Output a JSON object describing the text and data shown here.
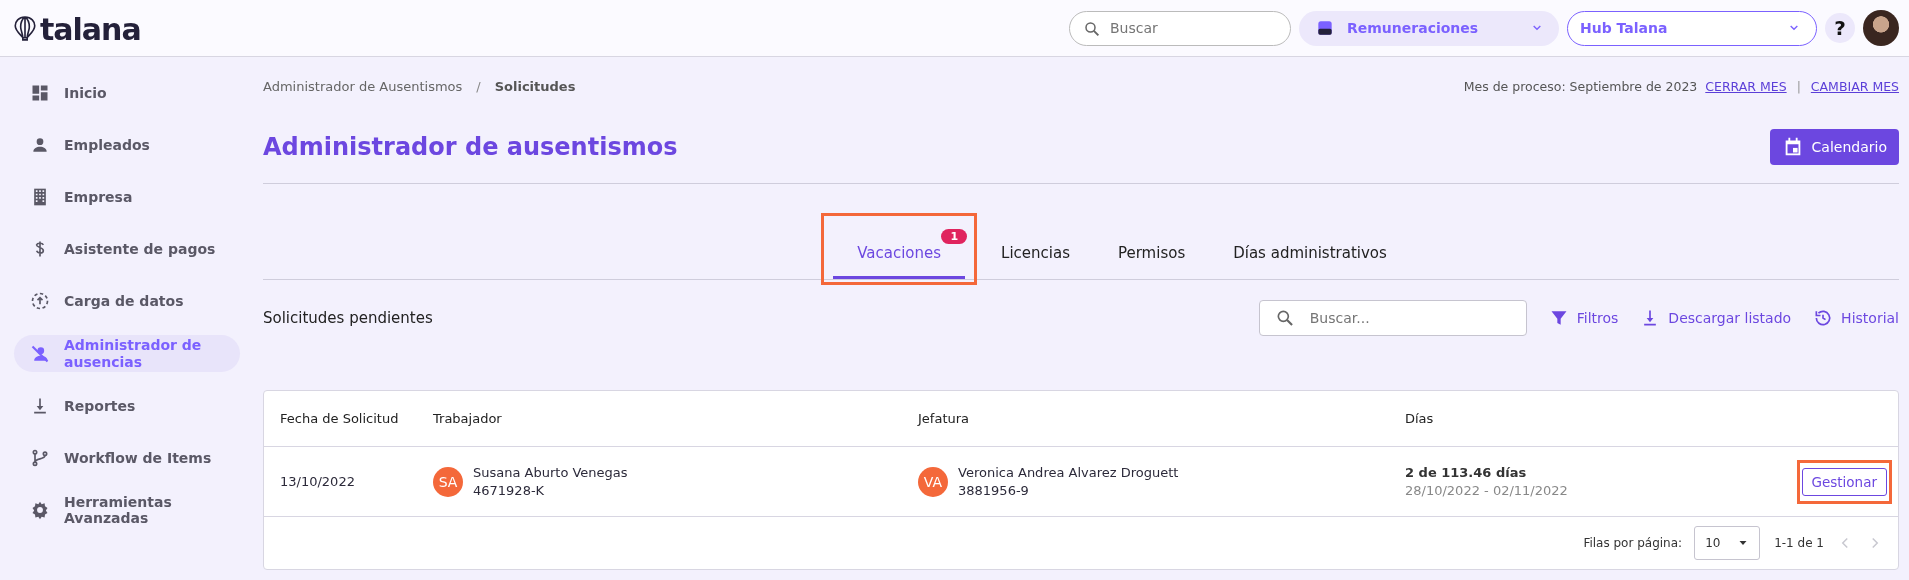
{
  "header": {
    "logo": "talana",
    "search": {
      "placeholder": "Buscar"
    },
    "module_select": "Remuneraciones",
    "hub_select": "Hub Talana",
    "help": "?"
  },
  "sidebar": {
    "items": [
      {
        "label": "Inicio",
        "selected": false
      },
      {
        "label": "Empleados",
        "selected": false
      },
      {
        "label": "Empresa",
        "selected": false
      },
      {
        "label": "Asistente de pagos",
        "selected": false
      },
      {
        "label": "Carga de datos",
        "selected": false
      },
      {
        "label": "Administrador de ausencias",
        "selected": true
      },
      {
        "label": "Reportes",
        "selected": false
      },
      {
        "label": "Workflow de Items",
        "selected": false
      },
      {
        "label": "Herramientas Avanzadas",
        "selected": false
      }
    ]
  },
  "breadcrumb": {
    "items": [
      "Administrador de Ausentismos",
      "Solicitudes"
    ],
    "separator": "/"
  },
  "process": {
    "label": "Mes de proceso: Septiembre de 2023",
    "links": [
      "CERRAR MES",
      "CAMBIAR MES"
    ],
    "separator": "|"
  },
  "page_title": "Administrador de ausentismos",
  "calendar_button": "Calendario",
  "tabs": [
    {
      "label": "Vacaciones",
      "selected": true,
      "badge": "1",
      "highlighted": true
    },
    {
      "label": "Licencias",
      "selected": false,
      "highlighted": false
    },
    {
      "label": "Permisos",
      "selected": false,
      "highlighted": false
    },
    {
      "label": "Días administrativos",
      "selected": false,
      "highlighted": false
    }
  ],
  "section_title": "Solicitudes pendientes",
  "list_search": {
    "placeholder": "Buscar..."
  },
  "actions": [
    {
      "label": "Filtros"
    },
    {
      "label": "Descargar listado"
    },
    {
      "label": "Historial"
    }
  ],
  "table": {
    "columns": [
      "Fecha de Solicitud",
      "Trabajador",
      "Jefatura",
      "Días"
    ],
    "rows": [
      {
        "date": "13/10/2022",
        "worker": {
          "initials": "SA",
          "name": "Susana Aburto Venegas",
          "rut": "4671928-K"
        },
        "boss": {
          "initials": "VA",
          "name": "Veronica Andrea Alvarez Droguett",
          "rut": "3881956-9"
        },
        "days": "2 de 113.46 días",
        "range": "28/10/2022 - 02/11/2022",
        "action": "Gestionar",
        "action_highlighted": true
      }
    ]
  },
  "pagination": {
    "label": "Filas por página:",
    "rows_per_page": "10",
    "range": "1-1 de 1"
  }
}
